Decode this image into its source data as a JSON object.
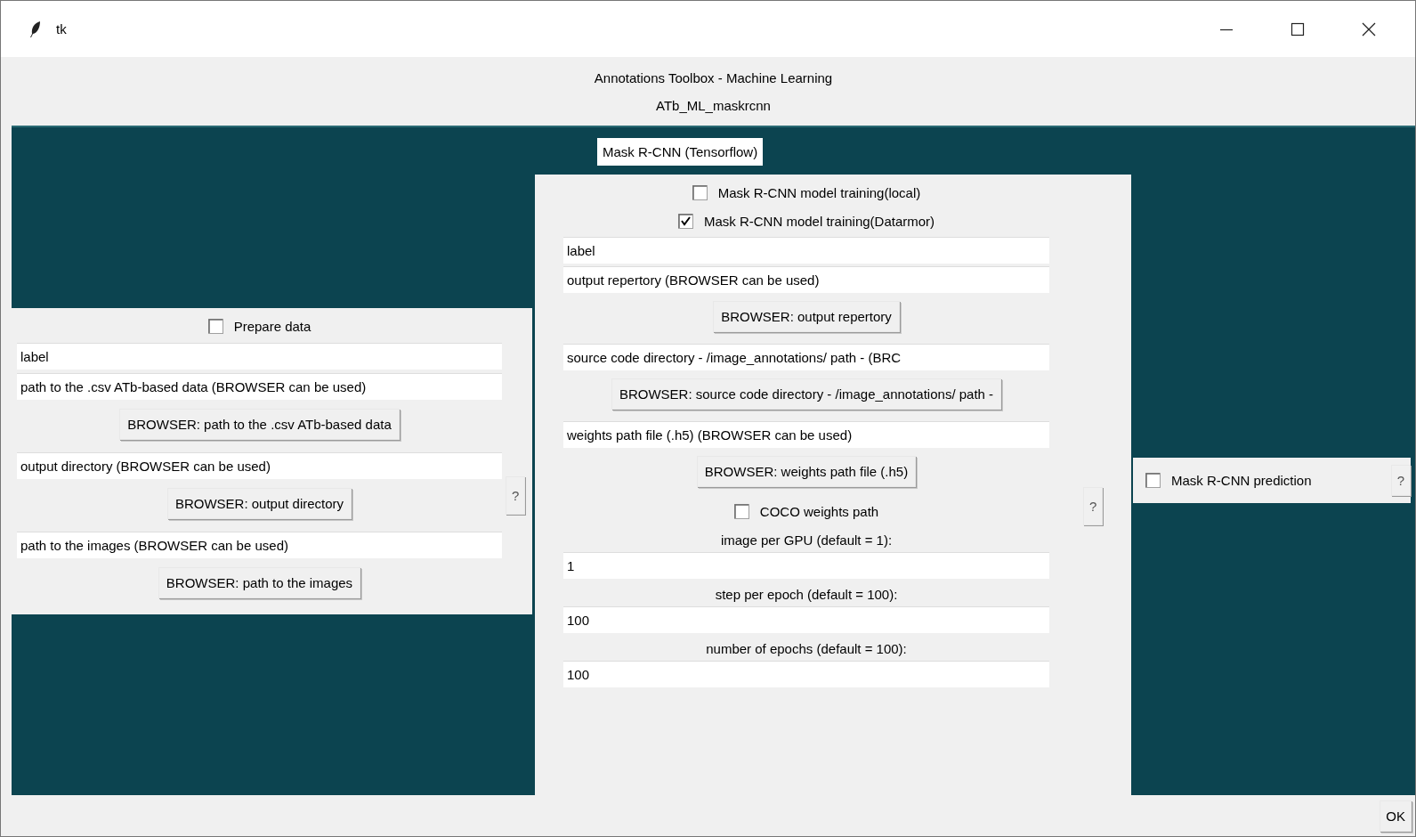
{
  "window": {
    "title": "tk"
  },
  "header": {
    "title": "Annotations Toolbox - Machine Learning",
    "subtitle": "ATb_ML_maskrcnn"
  },
  "frame_title": "Mask R-CNN (Tensorflow)",
  "prepare_panel": {
    "help": "?",
    "items": [
      {
        "kind": "checkbox",
        "label": "Prepare data",
        "checked": false
      },
      {
        "kind": "field",
        "value": "label"
      },
      {
        "kind": "field",
        "value": "path to the .csv ATb-based data (BROWSER can be used)"
      },
      {
        "kind": "button",
        "label": "BROWSER: path to the .csv ATb-based data"
      },
      {
        "kind": "field",
        "value": "output directory (BROWSER can be used)"
      },
      {
        "kind": "button",
        "label": "BROWSER: output directory"
      },
      {
        "kind": "field",
        "value": "path to the images (BROWSER can be used)"
      },
      {
        "kind": "button",
        "label": "BROWSER: path to the images"
      }
    ]
  },
  "training_panel": {
    "help": "?",
    "items": [
      {
        "kind": "checkbox",
        "label": "Mask R-CNN model training(local)",
        "checked": false
      },
      {
        "kind": "checkbox",
        "label": "Mask R-CNN model training(Datarmor)",
        "checked": true
      },
      {
        "kind": "field",
        "value": "label"
      },
      {
        "kind": "field",
        "value": "output repertory (BROWSER can be used)"
      },
      {
        "kind": "button",
        "label": "BROWSER: output repertory"
      },
      {
        "kind": "field",
        "value": "source code directory - /image_annotations/ path - (BRC"
      },
      {
        "kind": "button",
        "label": "BROWSER: source code directory - /image_annotations/ path -"
      },
      {
        "kind": "field",
        "value": "weights path file (.h5) (BROWSER can be used)"
      },
      {
        "kind": "button",
        "label": "BROWSER: weights path file (.h5)"
      },
      {
        "kind": "checkbox",
        "label": "COCO weights path",
        "checked": false
      },
      {
        "kind": "caption",
        "label": "image per GPU (default = 1):"
      },
      {
        "kind": "field",
        "value": "1"
      },
      {
        "kind": "caption",
        "label": "step per epoch (default = 100):"
      },
      {
        "kind": "field",
        "value": "100"
      },
      {
        "kind": "caption",
        "label": "number of epochs (default = 100):"
      },
      {
        "kind": "field",
        "value": "100"
      }
    ]
  },
  "prediction_panel": {
    "checkbox": {
      "label": "Mask R-CNN prediction",
      "checked": false
    },
    "help": "?"
  },
  "ok_button": "OK"
}
